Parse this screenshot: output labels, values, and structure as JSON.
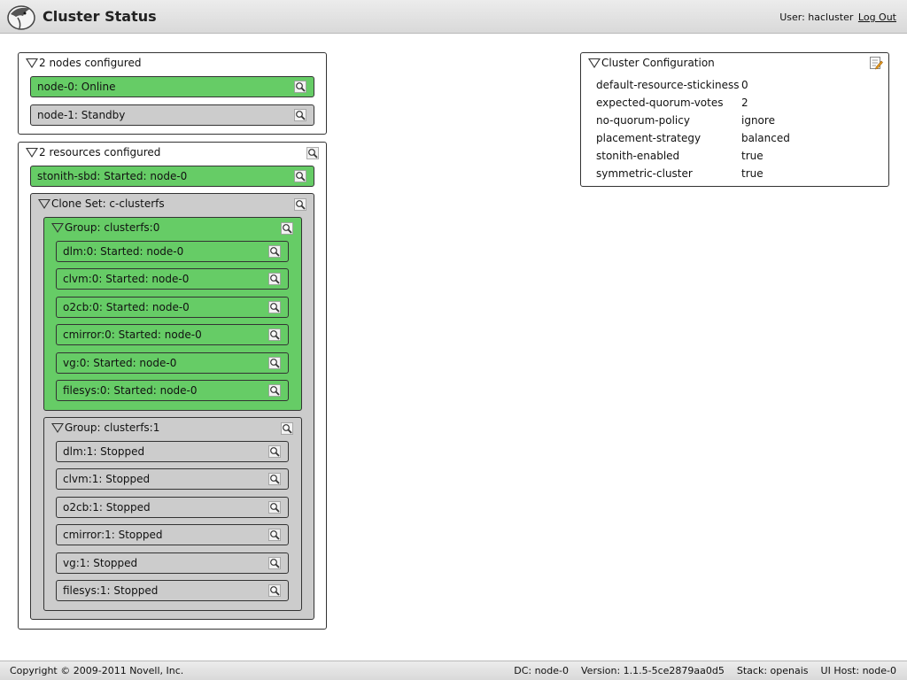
{
  "header": {
    "title": "Cluster Status",
    "user_label": "User: hacluster",
    "logout_label": "Log Out"
  },
  "nodes_panel": {
    "title": "2 nodes configured",
    "nodes": [
      {
        "label": "node-0: Online",
        "status": "online"
      },
      {
        "label": "node-1: Standby",
        "status": "standby"
      }
    ]
  },
  "resources_panel": {
    "title": "2 resources configured",
    "stonith": {
      "label": "stonith-sbd: Started: node-0",
      "status": "started"
    },
    "clone_set": {
      "title": "Clone Set: c-clusterfs",
      "groups": [
        {
          "title": "Group: clusterfs:0",
          "status": "started",
          "items": [
            "dlm:0: Started: node-0",
            "clvm:0: Started: node-0",
            "o2cb:0: Started: node-0",
            "cmirror:0: Started: node-0",
            "vg:0: Started: node-0",
            "filesys:0: Started: node-0"
          ]
        },
        {
          "title": "Group: clusterfs:1",
          "status": "stopped",
          "items": [
            "dlm:1: Stopped",
            "clvm:1: Stopped",
            "o2cb:1: Stopped",
            "cmirror:1: Stopped",
            "vg:1: Stopped",
            "filesys:1: Stopped"
          ]
        }
      ]
    }
  },
  "config_panel": {
    "title": "Cluster Configuration",
    "properties": [
      {
        "key": "default-resource-stickiness",
        "value": "0"
      },
      {
        "key": "expected-quorum-votes",
        "value": "2"
      },
      {
        "key": "no-quorum-policy",
        "value": "ignore"
      },
      {
        "key": "placement-strategy",
        "value": "balanced"
      },
      {
        "key": "stonith-enabled",
        "value": "true"
      },
      {
        "key": "symmetric-cluster",
        "value": "true"
      }
    ]
  },
  "footer": {
    "copyright": "Copyright © 2009-2011 Novell, Inc.",
    "dc": "DC: node-0",
    "version": "Version: 1.1.5-5ce2879aa0d5",
    "stack": "Stack: openais",
    "ui_host": "UI Host: node-0"
  },
  "colors": {
    "started": "#66cc66",
    "stopped": "#cccccc",
    "header_bg": "#dddddd"
  },
  "icons": {
    "details": "magnifier-icon",
    "edit": "edit-icon",
    "logo": "falcon-logo-icon"
  }
}
